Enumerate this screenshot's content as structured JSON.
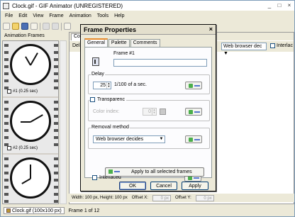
{
  "window": {
    "title": "Clock.gif - GIF Animator (UNREGISTERED)",
    "controls": [
      "_",
      "□",
      "×"
    ]
  },
  "menu": [
    "File",
    "Edit",
    "View",
    "Frame",
    "Animation",
    "Tools",
    "Help"
  ],
  "sidebar": {
    "header": "Animation Frames",
    "frames": [
      {
        "caption": "#1 (0.25 sec)"
      },
      {
        "caption": "#2 (0.25 sec)"
      }
    ]
  },
  "document": {
    "tab": "Com",
    "delay_label": "Del",
    "removal_value": "Web browser dec",
    "interlace_label": "Interlac",
    "status": {
      "size": "Width: 100 px, Height: 100 px",
      "offset_x_label": "Offset X:",
      "offset_x_value": "0 px",
      "offset_y_label": "Offset Y:",
      "offset_y_value": "0 px"
    }
  },
  "bottom": {
    "file_tab": "Clock.gif (100x100 px)",
    "frame_status": "Frame 1 of 12"
  },
  "dialog": {
    "title": "Frame Properties",
    "close": "×",
    "tabs": [
      "General",
      "Palette",
      "Comments"
    ],
    "frame_label": "Frame #1",
    "delay": {
      "label": "Delay",
      "value": "25",
      "unit": "1/100 of a sec."
    },
    "transparency": {
      "label": "Transparenc",
      "color_index_label": "Color index:",
      "color_index_value": "0"
    },
    "removal": {
      "label": "Removal method",
      "value": "Web browser decides"
    },
    "interlaced": {
      "label": "Interlaced"
    },
    "apply_all": "Apply to all selected frames",
    "buttons": {
      "ok": "OK",
      "cancel": "Cancel",
      "apply": "Apply"
    }
  }
}
